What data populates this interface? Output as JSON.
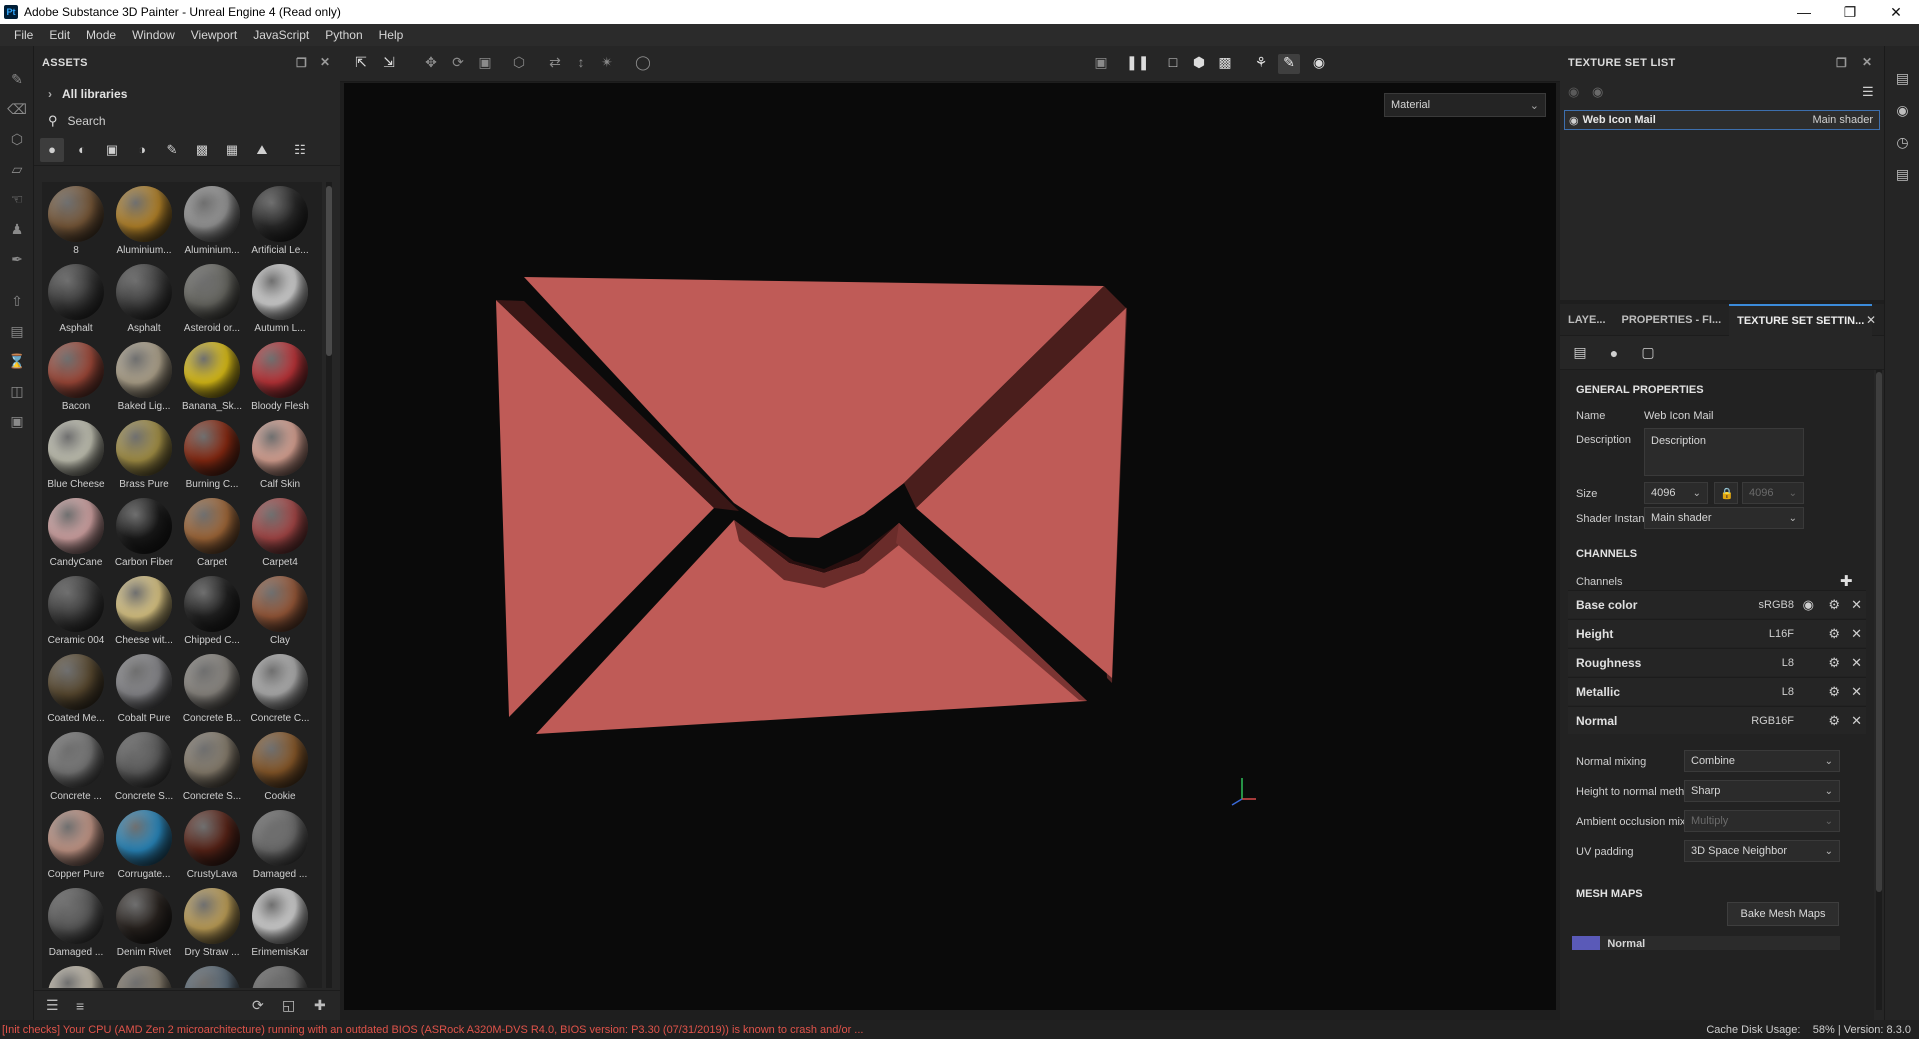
{
  "window": {
    "app_icon": "Pt",
    "title": "Adobe Substance 3D Painter - Unreal Engine 4 (Read only)",
    "buttons": [
      "minimize-icon",
      "restore-icon",
      "close-icon"
    ]
  },
  "menubar": [
    "File",
    "Edit",
    "Mode",
    "Window",
    "Viewport",
    "JavaScript",
    "Python",
    "Help"
  ],
  "assets": {
    "title": "ASSETS",
    "libraries_label": "All libraries",
    "search_placeholder": "Search",
    "items": [
      {
        "label": "8",
        "color": "#7a5a3a"
      },
      {
        "label": "Aluminium...",
        "color": "#b8862a"
      },
      {
        "label": "Aluminium...",
        "color": "#9a9a9a"
      },
      {
        "label": "Artificial Le...",
        "color": "#2a2a2a"
      },
      {
        "label": "Asphalt",
        "color": "#3a3a3a"
      },
      {
        "label": "Asphalt",
        "color": "#424242"
      },
      {
        "label": "Asteroid or...",
        "color": "#6a6a64"
      },
      {
        "label": "Autumn L...",
        "color": "#d8d8d8"
      },
      {
        "label": "Bacon",
        "color": "#a24a3a"
      },
      {
        "label": "Baked Lig...",
        "color": "#b4a890"
      },
      {
        "label": "Banana_Sk...",
        "color": "#e2c418"
      },
      {
        "label": "Bloody Flesh",
        "color": "#c0353a"
      },
      {
        "label": "Blue Cheese",
        "color": "#c8c8b8"
      },
      {
        "label": "Brass Pure",
        "color": "#a89448"
      },
      {
        "label": "Burning C...",
        "color": "#8a2a12"
      },
      {
        "label": "Calf Skin",
        "color": "#e0a898"
      },
      {
        "label": "CandyCane",
        "color": "#d8a8a8"
      },
      {
        "label": "Carbon Fiber",
        "color": "#1a1a1a"
      },
      {
        "label": "Carpet",
        "color": "#a46a3a"
      },
      {
        "label": "Carpet4",
        "color": "#a84848"
      },
      {
        "label": "Ceramic 004",
        "color": "#3e3e3e"
      },
      {
        "label": "Cheese wit...",
        "color": "#e2cc88"
      },
      {
        "label": "Chipped C...",
        "color": "#222222"
      },
      {
        "label": "Clay",
        "color": "#9a5a3a"
      },
      {
        "label": "Coated Me...",
        "color": "#5a4a30"
      },
      {
        "label": "Cobalt Pure",
        "color": "#8a8a8e"
      },
      {
        "label": "Concrete B...",
        "color": "#8e8a84"
      },
      {
        "label": "Concrete C...",
        "color": "#b4b4b4"
      },
      {
        "label": "Concrete ...",
        "color": "#7a7a7a"
      },
      {
        "label": "Concrete S...",
        "color": "#5e5e5e"
      },
      {
        "label": "Concrete S...",
        "color": "#8a8070"
      },
      {
        "label": "Cookie",
        "color": "#8a5a2a"
      },
      {
        "label": "Copper Pure",
        "color": "#c89a8a"
      },
      {
        "label": "Corrugate...",
        "color": "#2a8ac0"
      },
      {
        "label": "CrustyLava",
        "color": "#5a2418"
      },
      {
        "label": "Damaged ...",
        "color": "#6e6e6e"
      },
      {
        "label": "Damaged ...",
        "color": "#5a5a5a"
      },
      {
        "label": "Denim Rivet",
        "color": "#2a2420"
      },
      {
        "label": "Dry Straw ...",
        "color": "#c4a45a"
      },
      {
        "label": "ErimemisKar",
        "color": "#d8d8d8"
      },
      {
        "label": "",
        "color": "#c8c0b0"
      },
      {
        "label": "",
        "color": "#8a8070"
      },
      {
        "label": "",
        "color": "#5a6a78"
      },
      {
        "label": "",
        "color": "#6a6a6a"
      }
    ]
  },
  "viewport": {
    "channel_select": "Material",
    "envelope_color": "#bf5b57"
  },
  "texture_set_list": {
    "title": "TEXTURE SET LIST",
    "item_name": "Web Icon Mail",
    "item_shader": "Main shader"
  },
  "settings": {
    "tabs": [
      "LAYE...",
      "PROPERTIES - FI...",
      "TEXTURE SET SETTIN..."
    ],
    "general_title": "GENERAL PROPERTIES",
    "name_label": "Name",
    "name_value": "Web Icon Mail",
    "description_label": "Description",
    "description_value": "Description",
    "size_label": "Size",
    "size_value": "4096",
    "size_value2": "4096",
    "shader_label": "Shader Instance",
    "shader_value": "Main shader",
    "channels_title": "CHANNELS",
    "channels_label": "Channels",
    "channels": [
      {
        "name": "Base color",
        "format": "sRGB8"
      },
      {
        "name": "Height",
        "format": "L16F"
      },
      {
        "name": "Roughness",
        "format": "L8"
      },
      {
        "name": "Metallic",
        "format": "L8"
      },
      {
        "name": "Normal",
        "format": "RGB16F"
      }
    ],
    "normal_mixing_label": "Normal mixing",
    "normal_mixing_value": "Combine",
    "height_normal_label": "Height to normal method",
    "height_normal_value": "Sharp",
    "ao_mixing_label": "Ambient occlusion mixing",
    "ao_mixing_value": "Multiply",
    "uv_padding_label": "UV padding",
    "uv_padding_value": "3D Space Neighbor",
    "mesh_maps_title": "MESH MAPS",
    "bake_button": "Bake Mesh Maps",
    "mesh_map_first": "Normal"
  },
  "status": {
    "warning": "[Init checks] Your CPU (AMD Zen 2 microarchitecture) running with an outdated BIOS (ASRock A320M-DVS R4.0, BIOS version: P3.30 (07/31/2019)) is known to crash and/or ...",
    "cache_label": "Cache Disk Usage:",
    "cache_value": "58%",
    "version": "| Version: 8.3.0"
  }
}
